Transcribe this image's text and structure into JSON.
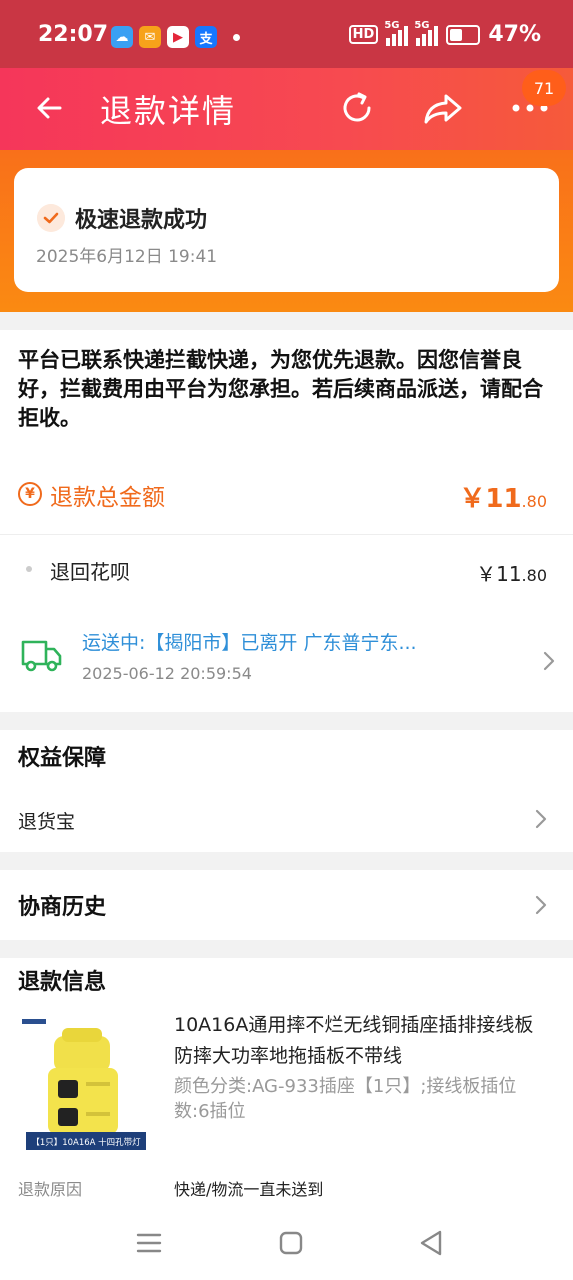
{
  "status_bar": {
    "time": "22:07",
    "hd_label": "HD",
    "signal1": "5G",
    "signal2": "5G",
    "battery": "47%"
  },
  "header": {
    "title": "退款详情",
    "badge_count": "71"
  },
  "status_card": {
    "status": "极速退款成功",
    "date": "2025年6月12日 19:41"
  },
  "notice": "平台已联系快递拦截快递，为您优先退款。因您信誉良好，拦截费用由平台为您承担。若后续商品派送，请配合拒收。",
  "refund_total": {
    "label": "退款总金额",
    "currency": "￥",
    "amount_int": "11",
    "amount_dec": ".80"
  },
  "refund_to": {
    "label": "退回花呗",
    "currency": "￥",
    "amount_int": "11",
    "amount_dec": ".80"
  },
  "shipping": {
    "status": "运送中:【揭阳市】已离开 广东普宁东...",
    "time": "2025-06-12 20:59:54"
  },
  "rights": {
    "title": "权益保障",
    "item": "退货宝"
  },
  "history": {
    "title": "协商历史"
  },
  "refund_info": {
    "title": "退款信息",
    "product_name": "10A16A通用摔不烂无线铜插座插排接线板防摔大功率地拖插板不带线",
    "product_spec": "颜色分类:AG-933插座【1只】;接线板插位数:6插位",
    "image_caption": "【1只】10A16A 十四孔带灯",
    "reason_label": "退款原因",
    "reason_value": "快递/物流一直未送到"
  },
  "colors": {
    "accent": "#f06a1c",
    "header": "#f5365a",
    "link": "#2f8fd8"
  }
}
